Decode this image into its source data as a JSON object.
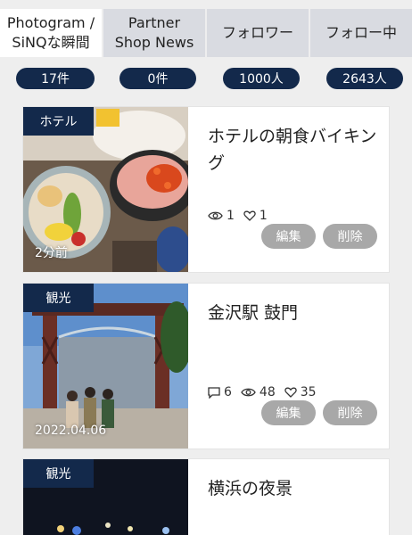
{
  "tabs": [
    {
      "label_line1": "Photogram /",
      "label_line2": "SiNQな瞬間"
    },
    {
      "label_line1": "Partner",
      "label_line2": "Shop News"
    },
    {
      "label_line1": "フォロワー",
      "label_line2": ""
    },
    {
      "label_line1": "フォロー中",
      "label_line2": ""
    }
  ],
  "counts": [
    "17件",
    "0件",
    "1000人",
    "2643人"
  ],
  "posts": [
    {
      "category": "ホテル",
      "title": "ホテルの朝食バイキング",
      "time": "2分前",
      "comments": "",
      "views": "1",
      "likes": "1",
      "edit_label": "編集",
      "delete_label": "削除"
    },
    {
      "category": "観光",
      "title": "金沢駅 鼓門",
      "time": "2022.04.06",
      "comments": "6",
      "views": "48",
      "likes": "35",
      "edit_label": "編集",
      "delete_label": "削除"
    },
    {
      "category": "観光",
      "title": "横浜の夜景"
    }
  ],
  "colors": {
    "navy": "#13294b",
    "tab_inactive": "#d9dbe1",
    "button_gray": "#a8a8a8",
    "background": "#eeeeee"
  },
  "icons": {
    "views": "eye-icon",
    "likes": "heart-icon",
    "comments": "comment-icon"
  }
}
